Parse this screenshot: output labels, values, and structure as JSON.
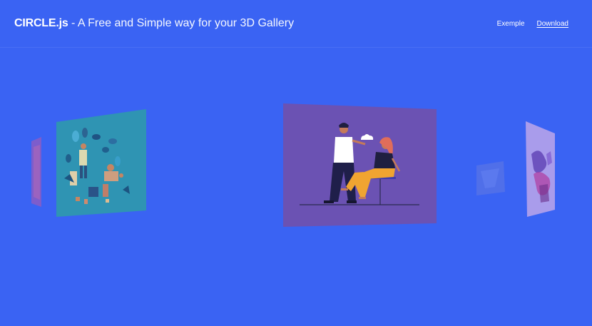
{
  "header": {
    "brand_name": "CIRCLE.js",
    "brand_tagline": " - A Free and Simple way for your 3D Gallery"
  },
  "nav": {
    "items": [
      {
        "label": "Exemple",
        "active": false
      },
      {
        "label": "Download",
        "active": true
      }
    ]
  },
  "colors": {
    "background": "#3a63f3",
    "center_card": "#6a52b4",
    "left_card": "#2e8fb2",
    "far_left_card": "#8f5fc0",
    "right_card": "#a79bee"
  },
  "gallery": {
    "cards": [
      {
        "name": "far-left-card",
        "image": "abstract-illustration"
      },
      {
        "name": "left-card",
        "image": "plants-people-illustration"
      },
      {
        "name": "center-card",
        "image": "couple-talking-illustration"
      },
      {
        "name": "right-faint-card",
        "image": "sketch-illustration"
      },
      {
        "name": "right-card",
        "image": "abstract-figures-illustration"
      }
    ]
  }
}
